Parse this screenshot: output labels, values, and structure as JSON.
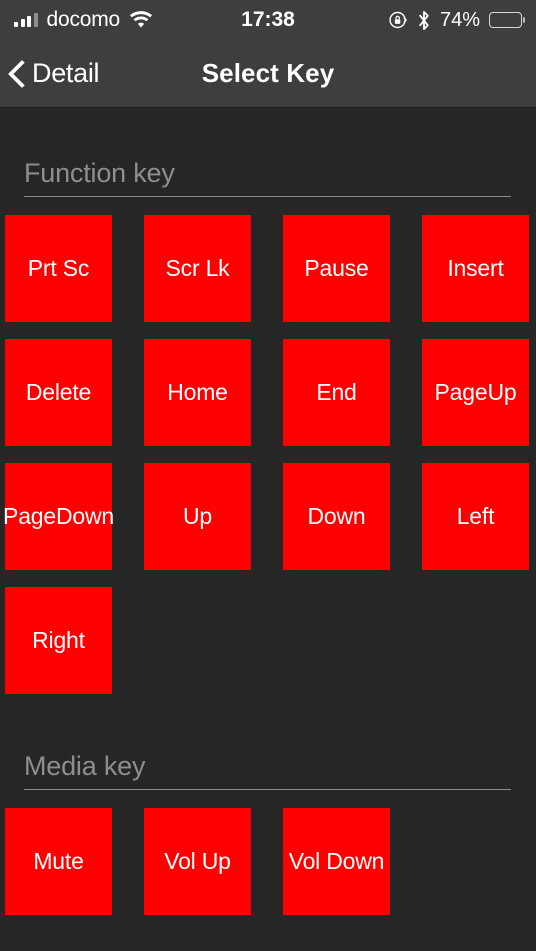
{
  "status_bar": {
    "signal_icon": "signal-bars-icon",
    "carrier": "docomo",
    "wifi_icon": "wifi-icon",
    "time": "17:38",
    "rotation_lock_icon": "rotation-lock-icon",
    "bluetooth_icon": "bluetooth-icon",
    "battery_percent": "74%",
    "battery_icon": "battery-icon",
    "battery_level": 74
  },
  "nav_bar": {
    "back_icon": "chevron-left-icon",
    "back_label": "Detail",
    "title": "Select Key"
  },
  "colors": {
    "background": "#262626",
    "bar": "#3e3e3e",
    "key": "#ff0000",
    "key_text": "#ffffff",
    "section_header": "#8e8e8e"
  },
  "sections": [
    {
      "header": "Function key",
      "keys": [
        "Prt Sc",
        "Scr Lk",
        "Pause",
        "Insert",
        "Delete",
        "Home",
        "End",
        "PageUp",
        "PageDown",
        "Up",
        "Down",
        "Left",
        "Right"
      ]
    },
    {
      "header": "Media key",
      "keys": [
        "Mute",
        "Vol Up",
        "Vol Down"
      ]
    }
  ]
}
